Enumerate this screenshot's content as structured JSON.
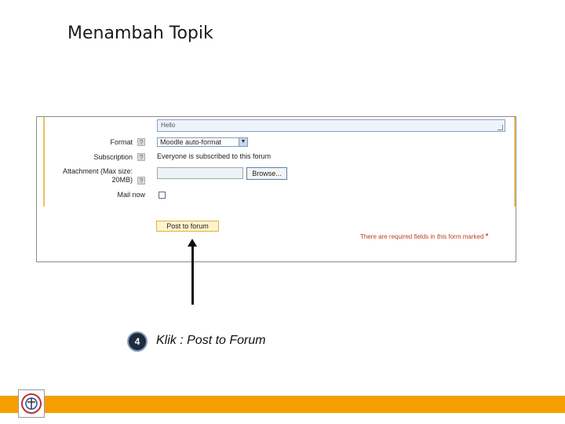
{
  "slide": {
    "title": "Menambah Topik",
    "step_number": "4",
    "step_text": "Klik : Post to Forum"
  },
  "form": {
    "message_text": "Hello",
    "format_label": "Format",
    "format_value": "Moodle auto-format",
    "subscription_label": "Subscription",
    "subscription_value": "Everyone is subscribed to this forum",
    "attachment_label_line1": "Attachment (Max size:",
    "attachment_label_line2": "20MB)",
    "browse_label": "Browse...",
    "mail_now_label": "Mail now",
    "help_glyph": "?",
    "select_arrow": "▼",
    "post_button_label": "Post to forum",
    "required_note": "There are required fields in this form marked",
    "required_mark": "*"
  },
  "colors": {
    "accent_orange": "#f5a000",
    "button_highlight": "#fff4cc",
    "step_badge": "#1e2b3e"
  }
}
